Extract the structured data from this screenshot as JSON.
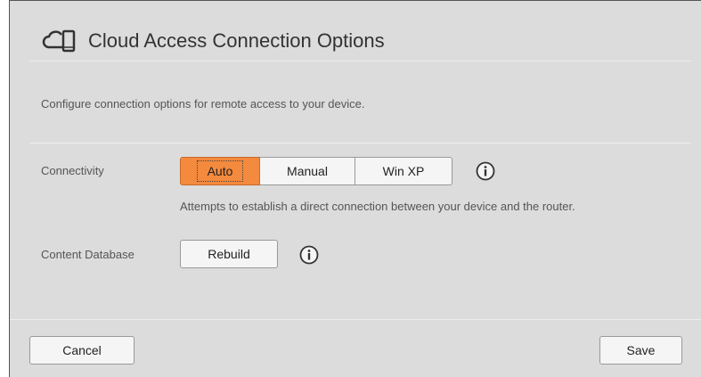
{
  "header": {
    "icon": "cloud-device-icon",
    "title": "Cloud Access Connection Options"
  },
  "description": "Configure connection options for remote access to your device.",
  "connectivity": {
    "label": "Connectivity",
    "options": [
      "Auto",
      "Manual",
      "Win XP"
    ],
    "selected": "Auto",
    "hint": "Attempts to establish a direct connection between your device and the router.",
    "info_icon": "info-icon"
  },
  "content_database": {
    "label": "Content Database",
    "button_label": "Rebuild",
    "info_icon": "info-icon"
  },
  "footer": {
    "cancel_label": "Cancel",
    "save_label": "Save"
  },
  "colors": {
    "accent": "#f48a3e",
    "panel_bg": "#dcdcdc",
    "button_bg": "#f5f5f5"
  }
}
